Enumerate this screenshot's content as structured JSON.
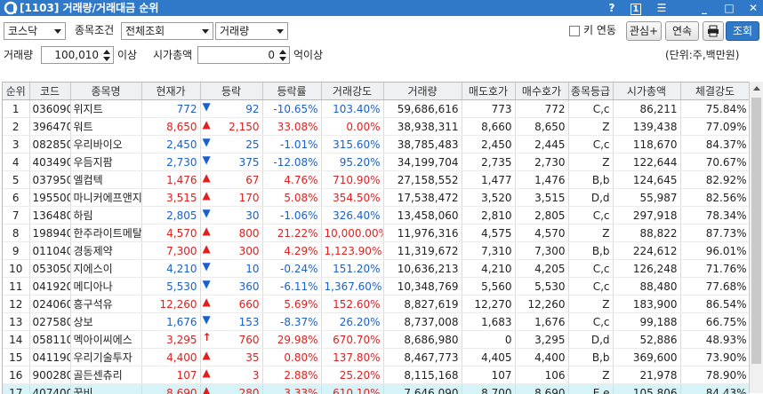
{
  "title": "[1103] 거래량/거래대금 순위",
  "titlebar": {
    "help": "?",
    "one": "1",
    "menu": "☰",
    "min": "_",
    "max": "□",
    "close": "✕"
  },
  "filters": {
    "market": "코스닥",
    "cond_label": "종목조건",
    "cond": "전체조회",
    "sort": "거래량",
    "key_link_label": "키 연동",
    "interest_btn": "관심+",
    "continue_btn": "연속",
    "search_btn": "조회",
    "volume_label": "거래량",
    "volume_value": "100,010",
    "volume_suffix": "이상",
    "mcap_label": "시가총액",
    "mcap_value": "0",
    "mcap_suffix": "억이상",
    "unit_text": "(단위:주,백만원)"
  },
  "columns": [
    "순위",
    "코드",
    "종목명",
    "현재가",
    "등락",
    "등락률",
    "거래강도",
    "거래량",
    "매도호가",
    "매수호가",
    "종목등급",
    "시가총액",
    "체결강도"
  ],
  "rows": [
    {
      "rank": "1",
      "code": "036090",
      "name": "위지트",
      "price": "772",
      "dir": "down",
      "chg": "92",
      "rate": "-10.65%",
      "power": "103.40%",
      "vol": "59,686,616",
      "ask": "773",
      "bid": "772",
      "grade": "C,c",
      "mcap": "86,211",
      "strength": "75.84%"
    },
    {
      "rank": "2",
      "code": "396470",
      "name": "워트",
      "price": "8,650",
      "dir": "up",
      "chg": "2,150",
      "rate": "33.08%",
      "power": "0.00%",
      "vol": "38,938,311",
      "ask": "8,660",
      "bid": "8,650",
      "grade": "Z",
      "mcap": "139,438",
      "strength": "77.09%"
    },
    {
      "rank": "3",
      "code": "082850",
      "name": "우리바이오",
      "price": "2,450",
      "dir": "down",
      "chg": "25",
      "rate": "-1.01%",
      "power": "315.60%",
      "vol": "38,785,483",
      "ask": "2,450",
      "bid": "2,445",
      "grade": "C,c",
      "mcap": "118,670",
      "strength": "84.37%"
    },
    {
      "rank": "4",
      "code": "403490",
      "name": "우듬지팜",
      "price": "2,730",
      "dir": "down",
      "chg": "375",
      "rate": "-12.08%",
      "power": "95.20%",
      "vol": "34,199,704",
      "ask": "2,735",
      "bid": "2,730",
      "grade": "Z",
      "mcap": "122,644",
      "strength": "70.67%"
    },
    {
      "rank": "5",
      "code": "037950",
      "name": "엘컴텍",
      "price": "1,476",
      "dir": "up",
      "chg": "67",
      "rate": "4.76%",
      "power": "710.90%",
      "vol": "27,158,552",
      "ask": "1,477",
      "bid": "1,476",
      "grade": "B,b",
      "mcap": "124,645",
      "strength": "82.92%"
    },
    {
      "rank": "6",
      "code": "195500",
      "name": "마니커에프앤지",
      "price": "3,515",
      "dir": "up",
      "chg": "170",
      "rate": "5.08%",
      "power": "354.50%",
      "vol": "17,538,472",
      "ask": "3,520",
      "bid": "3,515",
      "grade": "D,d",
      "mcap": "55,987",
      "strength": "82.56%"
    },
    {
      "rank": "7",
      "code": "136480",
      "name": "하림",
      "price": "2,805",
      "dir": "down",
      "chg": "30",
      "rate": "-1.06%",
      "power": "326.40%",
      "vol": "13,458,060",
      "ask": "2,810",
      "bid": "2,805",
      "grade": "C,c",
      "mcap": "297,918",
      "strength": "78.34%"
    },
    {
      "rank": "8",
      "code": "198940",
      "name": "한주라이트메탈",
      "price": "4,570",
      "dir": "up",
      "chg": "800",
      "rate": "21.22%",
      "power": "10,000.00%",
      "vol": "11,976,316",
      "ask": "4,575",
      "bid": "4,570",
      "grade": "Z",
      "mcap": "88,822",
      "strength": "87.73%"
    },
    {
      "rank": "9",
      "code": "011040",
      "name": "경동제약",
      "price": "7,300",
      "dir": "up",
      "chg": "300",
      "rate": "4.29%",
      "power": "1,123.90%",
      "vol": "11,319,672",
      "ask": "7,310",
      "bid": "7,300",
      "grade": "B,b",
      "mcap": "224,612",
      "strength": "96.01%"
    },
    {
      "rank": "10",
      "code": "053050",
      "name": "지에스이",
      "price": "4,210",
      "dir": "down",
      "chg": "10",
      "rate": "-0.24%",
      "power": "151.20%",
      "vol": "10,636,213",
      "ask": "4,210",
      "bid": "4,205",
      "grade": "C,c",
      "mcap": "126,248",
      "strength": "71.76%"
    },
    {
      "rank": "11",
      "code": "041920",
      "name": "메디아나",
      "price": "5,530",
      "dir": "down",
      "chg": "360",
      "rate": "-6.11%",
      "power": "1,367.60%",
      "vol": "10,348,769",
      "ask": "5,560",
      "bid": "5,530",
      "grade": "C,c",
      "mcap": "88,480",
      "strength": "77.68%"
    },
    {
      "rank": "12",
      "code": "024060",
      "name": "흥구석유",
      "price": "12,260",
      "dir": "up",
      "chg": "660",
      "rate": "5.69%",
      "power": "152.60%",
      "vol": "8,827,619",
      "ask": "12,270",
      "bid": "12,260",
      "grade": "Z",
      "mcap": "183,900",
      "strength": "86.54%"
    },
    {
      "rank": "13",
      "code": "027580",
      "name": "상보",
      "price": "1,676",
      "dir": "down",
      "chg": "153",
      "rate": "-8.37%",
      "power": "26.20%",
      "vol": "8,737,008",
      "ask": "1,683",
      "bid": "1,676",
      "grade": "C,c",
      "mcap": "99,188",
      "strength": "66.75%"
    },
    {
      "rank": "14",
      "code": "058110",
      "name": "멕아이씨에스",
      "price": "3,295",
      "dir": "limit",
      "chg": "760",
      "rate": "29.98%",
      "power": "670.70%",
      "vol": "8,686,980",
      "ask": "0",
      "bid": "3,295",
      "grade": "D,d",
      "mcap": "52,886",
      "strength": "48.93%"
    },
    {
      "rank": "15",
      "code": "041190",
      "name": "우리기술투자",
      "price": "4,400",
      "dir": "up",
      "chg": "35",
      "rate": "0.80%",
      "power": "137.80%",
      "vol": "8,467,773",
      "ask": "4,405",
      "bid": "4,400",
      "grade": "B,b",
      "mcap": "369,600",
      "strength": "73.90%"
    },
    {
      "rank": "16",
      "code": "900280",
      "name": "골든센츄리",
      "price": "107",
      "dir": "up",
      "chg": "3",
      "rate": "2.88%",
      "power": "25.20%",
      "vol": "8,115,168",
      "ask": "107",
      "bid": "106",
      "grade": "Z",
      "mcap": "21,978",
      "strength": "78.90%"
    },
    {
      "rank": "17",
      "code": "407400",
      "name": "꿈비",
      "price": "8,690",
      "dir": "up",
      "chg": "280",
      "rate": "3.33%",
      "power": "610.10%",
      "vol": "7,646,090",
      "ask": "8,700",
      "bid": "8,690",
      "grade": "E,e",
      "mcap": "105,806",
      "strength": "84.43%"
    }
  ]
}
